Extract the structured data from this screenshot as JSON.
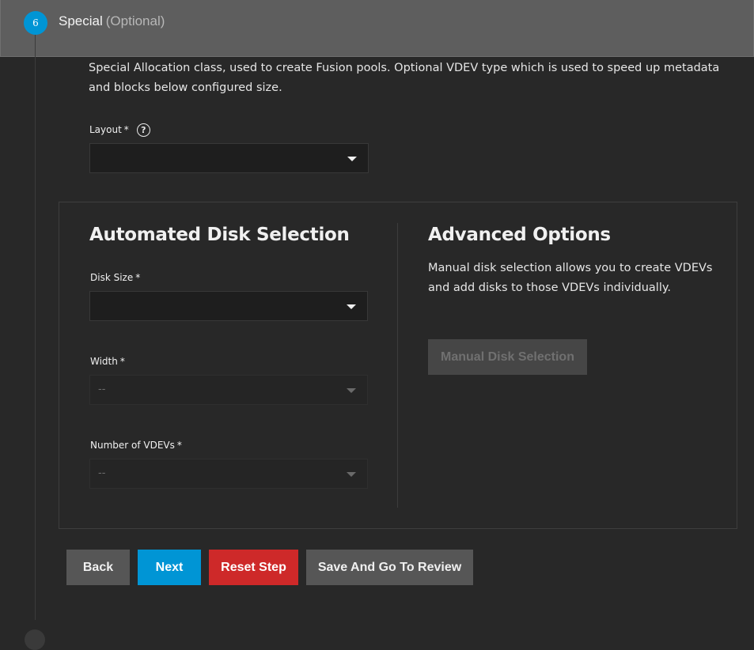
{
  "step": {
    "number": "6",
    "title": "Special",
    "optional_label": "(Optional)"
  },
  "description": "Special Allocation class, used to create Fusion pools. Optional VDEV type which is used to speed up metadata and blocks below configured size.",
  "layout_field": {
    "label": "Layout",
    "required_mark": "*",
    "help_icon": "?",
    "value": ""
  },
  "automated": {
    "title": "Automated Disk Selection",
    "disk_size": {
      "label": "Disk Size",
      "required_mark": "*",
      "value": ""
    },
    "width": {
      "label": "Width",
      "required_mark": "*",
      "value": "--"
    },
    "num_vdevs": {
      "label": "Number of VDEVs",
      "required_mark": "*",
      "value": "--"
    }
  },
  "advanced": {
    "title": "Advanced Options",
    "text": "Manual disk selection allows you to create VDEVs and add disks to those VDEVs individually.",
    "manual_button": "Manual Disk Selection"
  },
  "actions": {
    "back": "Back",
    "next": "Next",
    "reset": "Reset Step",
    "save_review": "Save And Go To Review"
  },
  "colors": {
    "accent": "#0095d5",
    "danger": "#ce2929",
    "background": "#282828"
  }
}
